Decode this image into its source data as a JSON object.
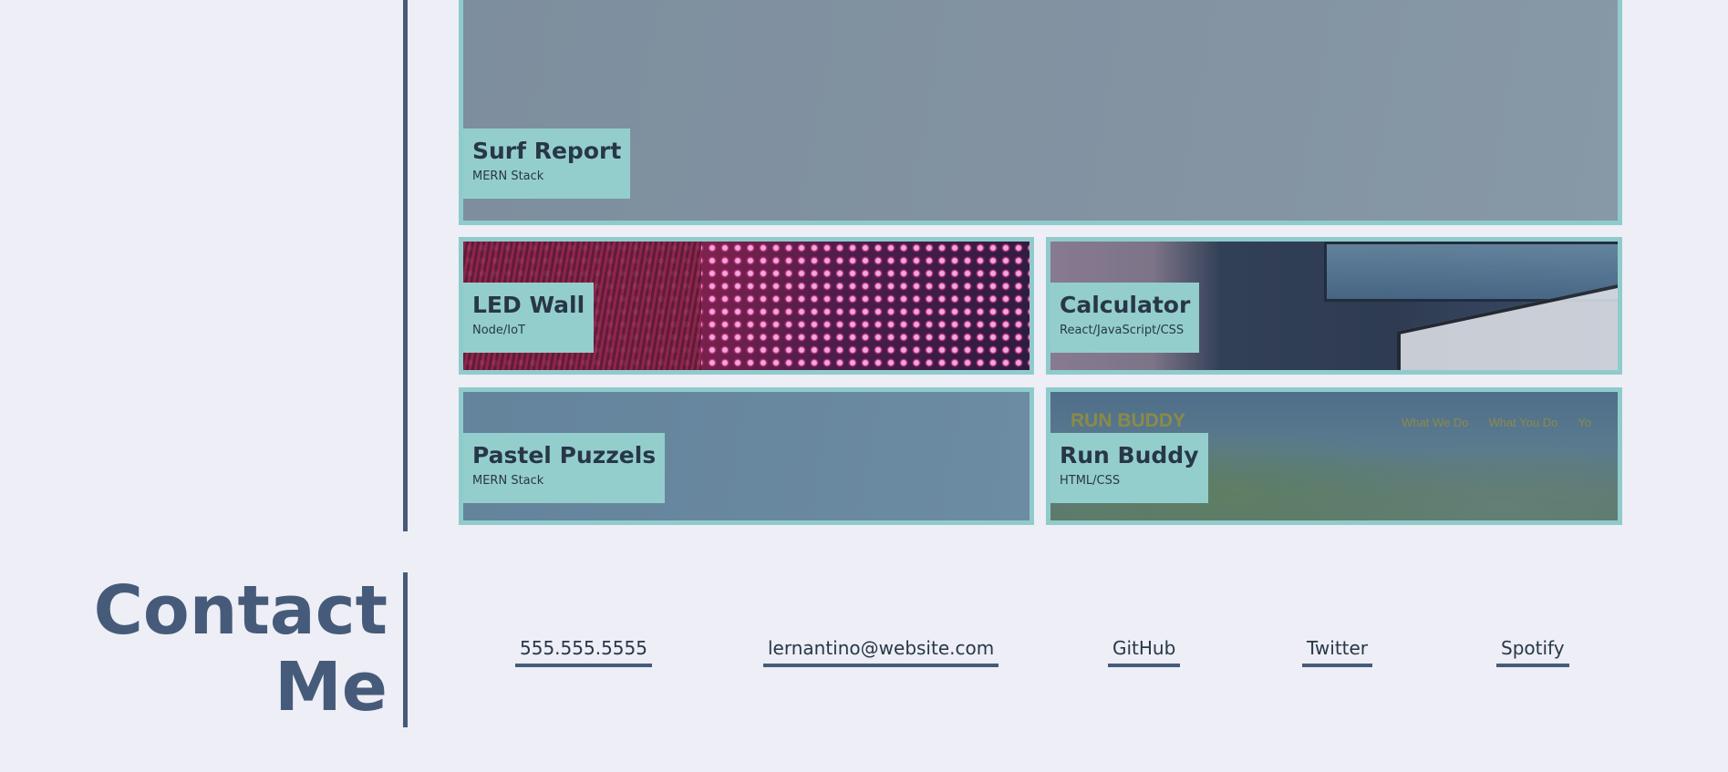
{
  "projects": [
    {
      "id": "surf",
      "title": "Surf Report",
      "stack": "MERN Stack"
    },
    {
      "id": "led",
      "title": "LED Wall",
      "stack": "Node/IoT"
    },
    {
      "id": "calc",
      "title": "Calculator",
      "stack": "React/JavaScript/CSS"
    },
    {
      "id": "pastel",
      "title": "Pastel Puzzels",
      "stack": "MERN Stack"
    },
    {
      "id": "run",
      "title": "Run Buddy",
      "stack": "HTML/CSS"
    }
  ],
  "run_buddy_preview": {
    "logo": "RUN BUDDY",
    "nav": [
      "What We Do",
      "What You Do",
      "Yo"
    ]
  },
  "contact": {
    "title_line1": "Contact",
    "title_line2": "Me",
    "links": [
      {
        "label": "555.555.5555"
      },
      {
        "label": "lernantino@website.com"
      },
      {
        "label": "GitHub"
      },
      {
        "label": "Twitter"
      },
      {
        "label": "Spotify"
      }
    ]
  },
  "colors": {
    "background": "#edeef6",
    "accent": "#465b7a",
    "card_border": "#90cbcc",
    "caption_bg": "#93cecd",
    "text_dark": "#283747"
  }
}
